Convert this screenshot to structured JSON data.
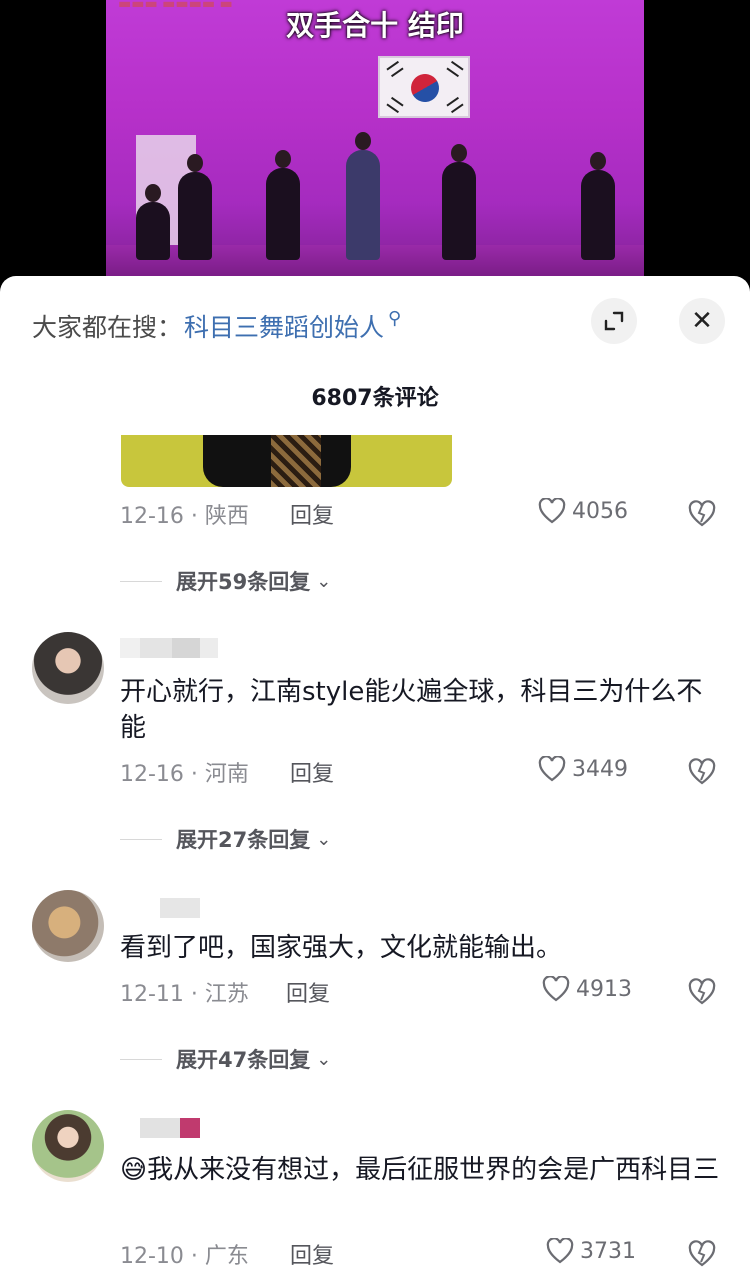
{
  "video": {
    "caption": "双手合十 结印"
  },
  "sheet": {
    "search_prefix": "大家都在搜：",
    "search_term": "科目三舞蹈创始人",
    "comment_count": "6807条评论",
    "close_symbol": "✕"
  },
  "top_comment": {
    "date_region": "12-16 · 陕西",
    "reply_label": "回复",
    "likes": "4056",
    "expand_label": "展开59条回复"
  },
  "comments": [
    {
      "text": "开心就行，江南style能火遍全球，科目三为什么不能",
      "date_region": "12-16 · 河南",
      "reply_label": "回复",
      "likes": "3449",
      "expand_label": "展开27条回复"
    },
    {
      "text": "看到了吧，国家强大，文化就能输出。",
      "date_region": "12-11 · 江苏",
      "reply_label": "回复",
      "likes": "4913",
      "expand_label": "展开47条回复"
    },
    {
      "emoji": "😅",
      "text": "我从来没有想过，最后征服世界的会是广西科目三",
      "date_region": "12-10 · 广东",
      "reply_label": "回复",
      "likes": "3731"
    }
  ],
  "icons": {
    "expand": "expand-icon",
    "close": "close-icon",
    "search": "search-icon",
    "like": "heart-icon",
    "dislike": "broken-heart-icon",
    "chevron": "chevron-down-icon"
  },
  "colors": {
    "search_term": "#3e6fb0",
    "stage": "#b630c9"
  }
}
